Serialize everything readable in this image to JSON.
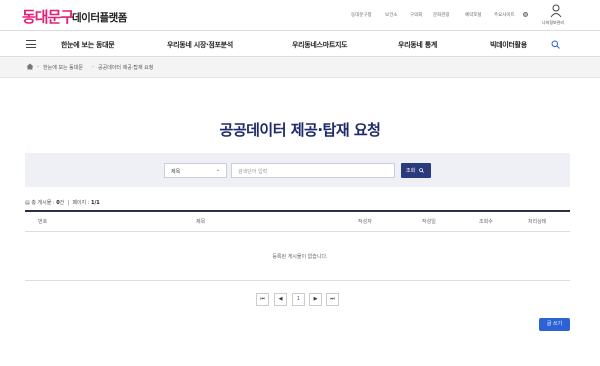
{
  "header": {
    "logo_text": "동대문구",
    "logo_sub": "데이터플랫폼",
    "utility_links": [
      "동대문구청",
      "보건소",
      "구의회",
      "문화관광",
      "예약포털",
      "주요사이트"
    ],
    "user_label": "나의정보관리"
  },
  "nav": {
    "items": [
      "한눈에 보는 동대문",
      "우리동네 시장·점포분석",
      "우리동네스마트지도",
      "우리동네 통계",
      "빅데이터활용"
    ]
  },
  "breadcrumb": {
    "items": [
      "한눈에 보는 동대문",
      "공공데이터 제공·탑재 요청"
    ]
  },
  "page": {
    "title": "공공데이터 제공·탑재 요청"
  },
  "search": {
    "select_value": "제목",
    "input_placeholder": "검색단어 입력",
    "button_label": "조회"
  },
  "summary": {
    "total_label": "총 게시물 :",
    "total_value": "0",
    "total_unit": "건",
    "page_label": "페이지 :",
    "page_value": "1/1"
  },
  "table": {
    "columns": [
      "번호",
      "제목",
      "작성자",
      "작성일",
      "조회수",
      "처리상태"
    ],
    "empty_message": "등록된 게시물이 없습니다."
  },
  "pagination": {
    "first": "⏮",
    "prev": "◀",
    "current": "1",
    "next": "▶",
    "last": "⏭"
  },
  "actions": {
    "write_label": "글 쓰기"
  },
  "colors": {
    "brand": "#e2207a",
    "title": "#1f2a6b",
    "primary_button": "#2b3a7a",
    "write_button": "#2d62d6"
  }
}
